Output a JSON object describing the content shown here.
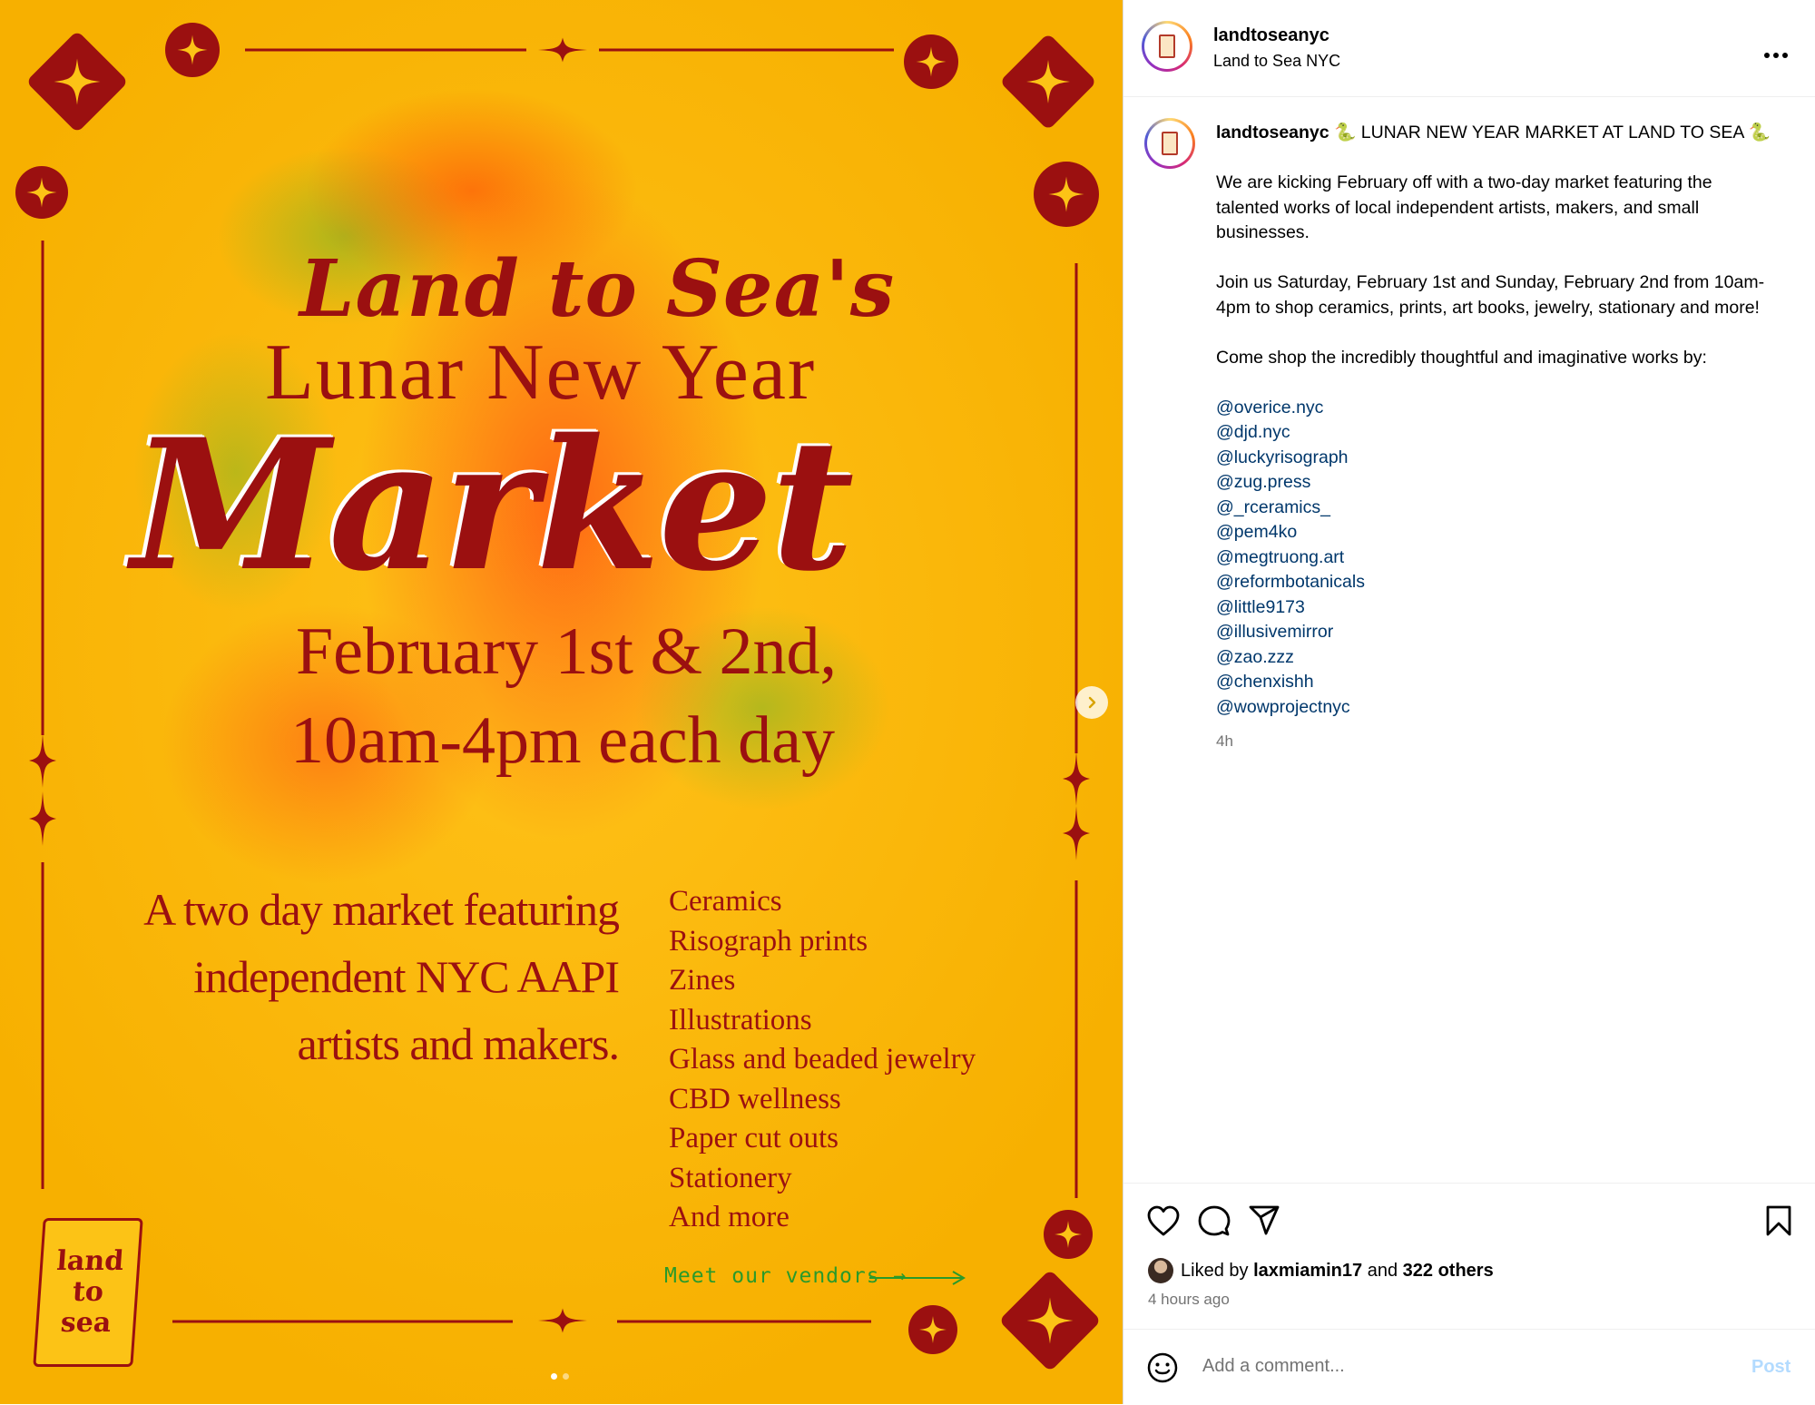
{
  "poster": {
    "script_title": "Land to Sea's",
    "subtitle": "Lunar New Year",
    "headline": "Market",
    "date_line_1": "February 1st & 2nd,",
    "date_line_2": "10am-4pm each day",
    "description_lines": [
      "A two day market featuring",
      "independent NYC AAPI",
      "artists and makers."
    ],
    "items": [
      "Ceramics",
      "Risograph prints",
      "Zines",
      "Illustrations",
      "Glass and beaded jewelry",
      "CBD wellness",
      "Paper cut outs",
      "Stationery",
      "And more"
    ],
    "vendors_link": "Meet our vendors →",
    "logo_lines": [
      "land",
      "to",
      "sea"
    ],
    "colors": {
      "ink": "#9b1010",
      "background": "#f7b000",
      "link_green": "#2a9a2a"
    }
  },
  "carousel": {
    "next_icon": "chevron-right-icon",
    "total_slides": 2,
    "active_slide": 1
  },
  "header": {
    "username": "landtoseanyc",
    "subtitle": "Land to Sea NYC",
    "more_icon": "more-horizontal-icon"
  },
  "caption": {
    "username": "landtoseanyc",
    "title": "🐍 LUNAR NEW YEAR MARKET AT LAND TO SEA 🐍",
    "paragraphs": [
      "We are kicking February off with a two-day market featuring the talented works of local independent artists, makers, and small businesses.",
      "Join us Saturday, February 1st and Sunday, February 2nd from 10am-4pm to shop ceramics, prints, art books, jewelry, stationary and more!",
      "Come shop the incredibly thoughtful and imaginative works by:"
    ],
    "mentions": [
      "@overice.nyc",
      "@djd.nyc",
      "@luckyrisograph",
      "@zug.press",
      "@_rceramics_",
      "@pem4ko",
      "@megtruong.art",
      "@reformbotanicals",
      "@little9173",
      "@illusivemirror",
      "@zao.zzz",
      "@chenxishh",
      "@wowprojectnyc"
    ],
    "time": "4h"
  },
  "actions": {
    "like_icon": "heart-icon",
    "comment_icon": "comment-icon",
    "share_icon": "send-icon",
    "save_icon": "bookmark-icon"
  },
  "likes": {
    "prefix": "Liked by",
    "user": "laxmiamin17",
    "joiner": "and",
    "others": "322 others"
  },
  "time_ago": "4 hours ago",
  "comment": {
    "placeholder": "Add a comment...",
    "post_label": "Post",
    "emoji_icon": "smiley-icon"
  },
  "colors": {
    "mention": "#00376b",
    "muted": "#737373",
    "post_disabled": "#b3dbff"
  }
}
